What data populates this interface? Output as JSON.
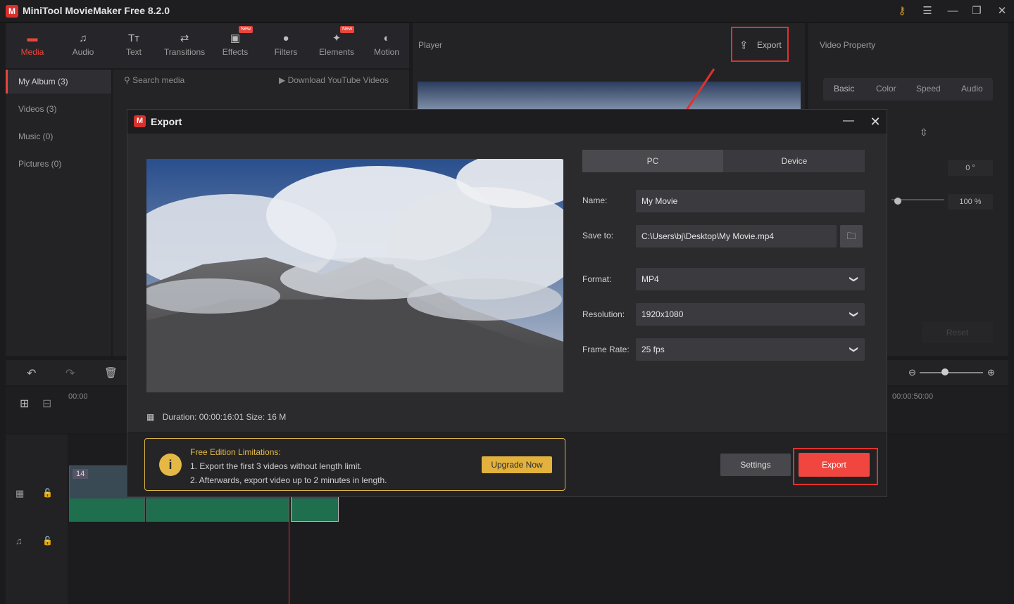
{
  "app": {
    "title": "MiniTool MovieMaker Free 8.2.0",
    "logo_letter": "M"
  },
  "toolbar": {
    "items": [
      {
        "label": "Media",
        "icon": "media-icon",
        "active": true
      },
      {
        "label": "Audio",
        "icon": "music-note-icon"
      },
      {
        "label": "Text",
        "icon": "text-icon"
      },
      {
        "label": "Transitions",
        "icon": "transitions-icon"
      },
      {
        "label": "Effects",
        "icon": "effects-icon",
        "badge": "New"
      },
      {
        "label": "Filters",
        "icon": "filters-icon"
      },
      {
        "label": "Elements",
        "icon": "elements-icon",
        "badge": "New"
      },
      {
        "label": "Motion",
        "icon": "motion-icon"
      }
    ]
  },
  "sidebar": {
    "items": [
      {
        "label": "My Album (3)",
        "active": true
      },
      {
        "label": "Videos (3)"
      },
      {
        "label": "Music (0)"
      },
      {
        "label": "Pictures (0)"
      }
    ]
  },
  "media": {
    "search_placeholder": "Search media",
    "download_label": "Download YouTube Videos"
  },
  "player": {
    "label": "Player",
    "export_label": "Export"
  },
  "video_property": {
    "label": "Video Property",
    "tabs": [
      "Basic",
      "Color",
      "Speed",
      "Audio"
    ],
    "rotation": "0 °",
    "scale": "100 %",
    "reset_label": "Reset"
  },
  "timeline": {
    "start_time": "00:00",
    "end_time": "00:00:50:00",
    "clip_count": "14"
  },
  "dialog": {
    "title": "Export",
    "tabs": [
      "PC",
      "Device"
    ],
    "active_tab": "PC",
    "duration_label": "Duration:",
    "duration": "00:00:16:01",
    "size_label": "Size:",
    "size": "16 M",
    "fields": {
      "name_label": "Name:",
      "name_value": "My Movie",
      "save_label": "Save to:",
      "save_value": "C:\\Users\\bj\\Desktop\\My Movie.mp4",
      "format_label": "Format:",
      "format_value": "MP4",
      "resolution_label": "Resolution:",
      "resolution_value": "1920x1080",
      "framerate_label": "Frame Rate:",
      "framerate_value": "25 fps"
    },
    "limitations": {
      "title": "Free Edition Limitations:",
      "line1": "1. Export the first 3 videos without length limit.",
      "line2": "2. Afterwards, export video up to 2 minutes in length.",
      "upgrade_label": "Upgrade Now"
    },
    "settings_label": "Settings",
    "export_label": "Export"
  },
  "colors": {
    "accent": "#e8453c",
    "highlight_box": "#e0322c",
    "warning": "#e5b845"
  }
}
